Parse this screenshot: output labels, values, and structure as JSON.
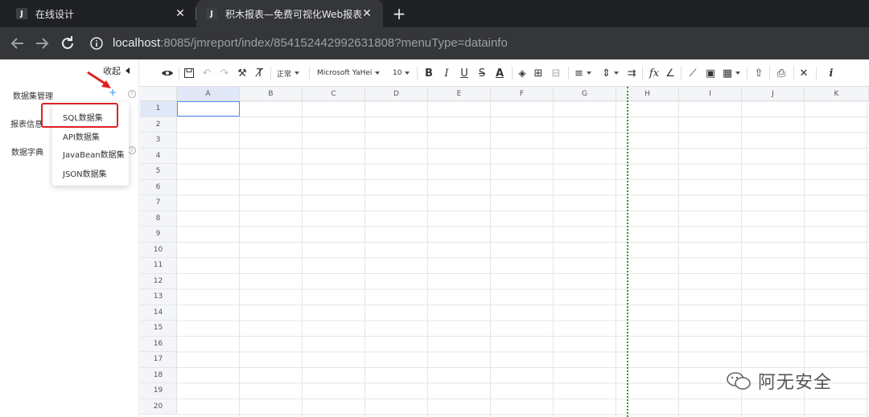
{
  "browser": {
    "tabs": [
      {
        "label": "在线设计",
        "favicon": "J"
      },
      {
        "label": "积木报表—免费可视化Web报表",
        "favicon": "J"
      }
    ],
    "url_host": "localhost",
    "url_rest": ":8085/jmreport/index/854152442992631808?menuType=datainfo"
  },
  "sidebar": {
    "collapse_label": "收起",
    "sections": [
      "数据集管理",
      "报表信息",
      "数据字典"
    ],
    "add_symbol": "+",
    "dropdown": [
      "SQL数据集",
      "API数据集",
      "JavaBean数据集",
      "JSON数据集"
    ]
  },
  "toolbar": {
    "format_label": "正常",
    "font_family": "Microsoft YaHei",
    "font_size": "10",
    "icons": [
      "eye-icon",
      "save-icon",
      "undo-icon",
      "redo-icon",
      "paint-format-icon",
      "clear-format-icon",
      "bold-icon",
      "italic-icon",
      "underline-icon",
      "strike-icon",
      "font-color-icon",
      "fill-color-icon",
      "border-icon",
      "merge-icon",
      "align-icon",
      "valign-icon",
      "wrap-icon",
      "formula-icon",
      "chart-icon",
      "image-icon",
      "qrcode-icon",
      "upload-icon",
      "print-icon",
      "close-icon",
      "info-icon"
    ]
  },
  "grid": {
    "columns": [
      "A",
      "B",
      "C",
      "D",
      "E",
      "F",
      "G",
      "H",
      "I",
      "J",
      "K"
    ],
    "rows": [
      "1",
      "2",
      "3",
      "4",
      "5",
      "6",
      "7",
      "8",
      "9",
      "10",
      "11",
      "12",
      "13",
      "14",
      "15",
      "16",
      "17",
      "18",
      "19",
      "20"
    ]
  },
  "watermark": {
    "text": "阿无安全"
  },
  "colors": {
    "accent": "#1890ff",
    "highlight": "#e02020",
    "print_line": "#1e9d2c"
  }
}
